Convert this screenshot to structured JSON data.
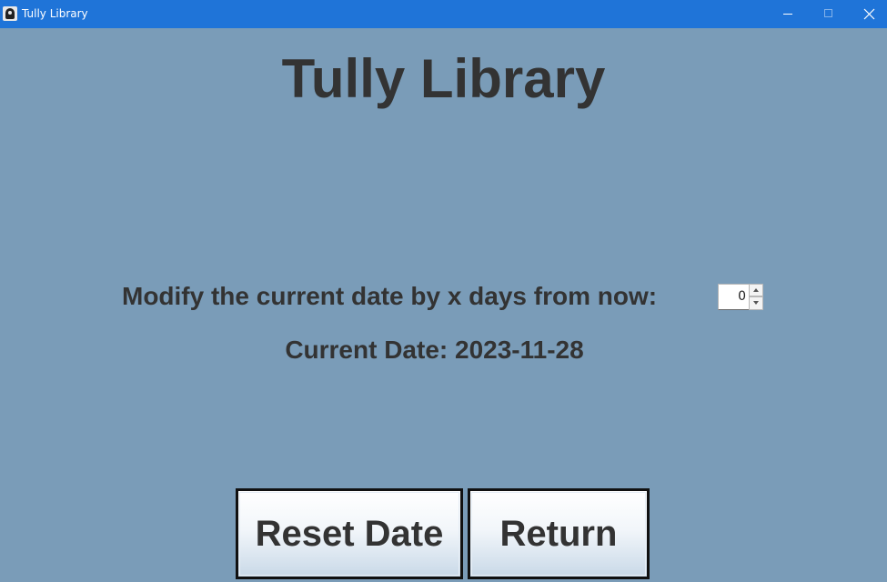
{
  "window": {
    "title": "Tully Library",
    "controls": [
      "minimize-icon",
      "maximize-icon",
      "close-icon"
    ]
  },
  "main": {
    "heading": "Tully Library",
    "modify_prompt": "Modify the current date by x days from now:",
    "days_spinner": {
      "value": "0",
      "up_icon": "caret-up-icon",
      "down_icon": "caret-down-icon"
    },
    "current_date": "Current Date: 2023-11-28"
  },
  "buttons": {
    "reset_label": "Reset Date",
    "return_label": "Return"
  },
  "colors": {
    "titlebar": "#1f74d8",
    "background": "#7a9cb8",
    "text": "#333333"
  }
}
